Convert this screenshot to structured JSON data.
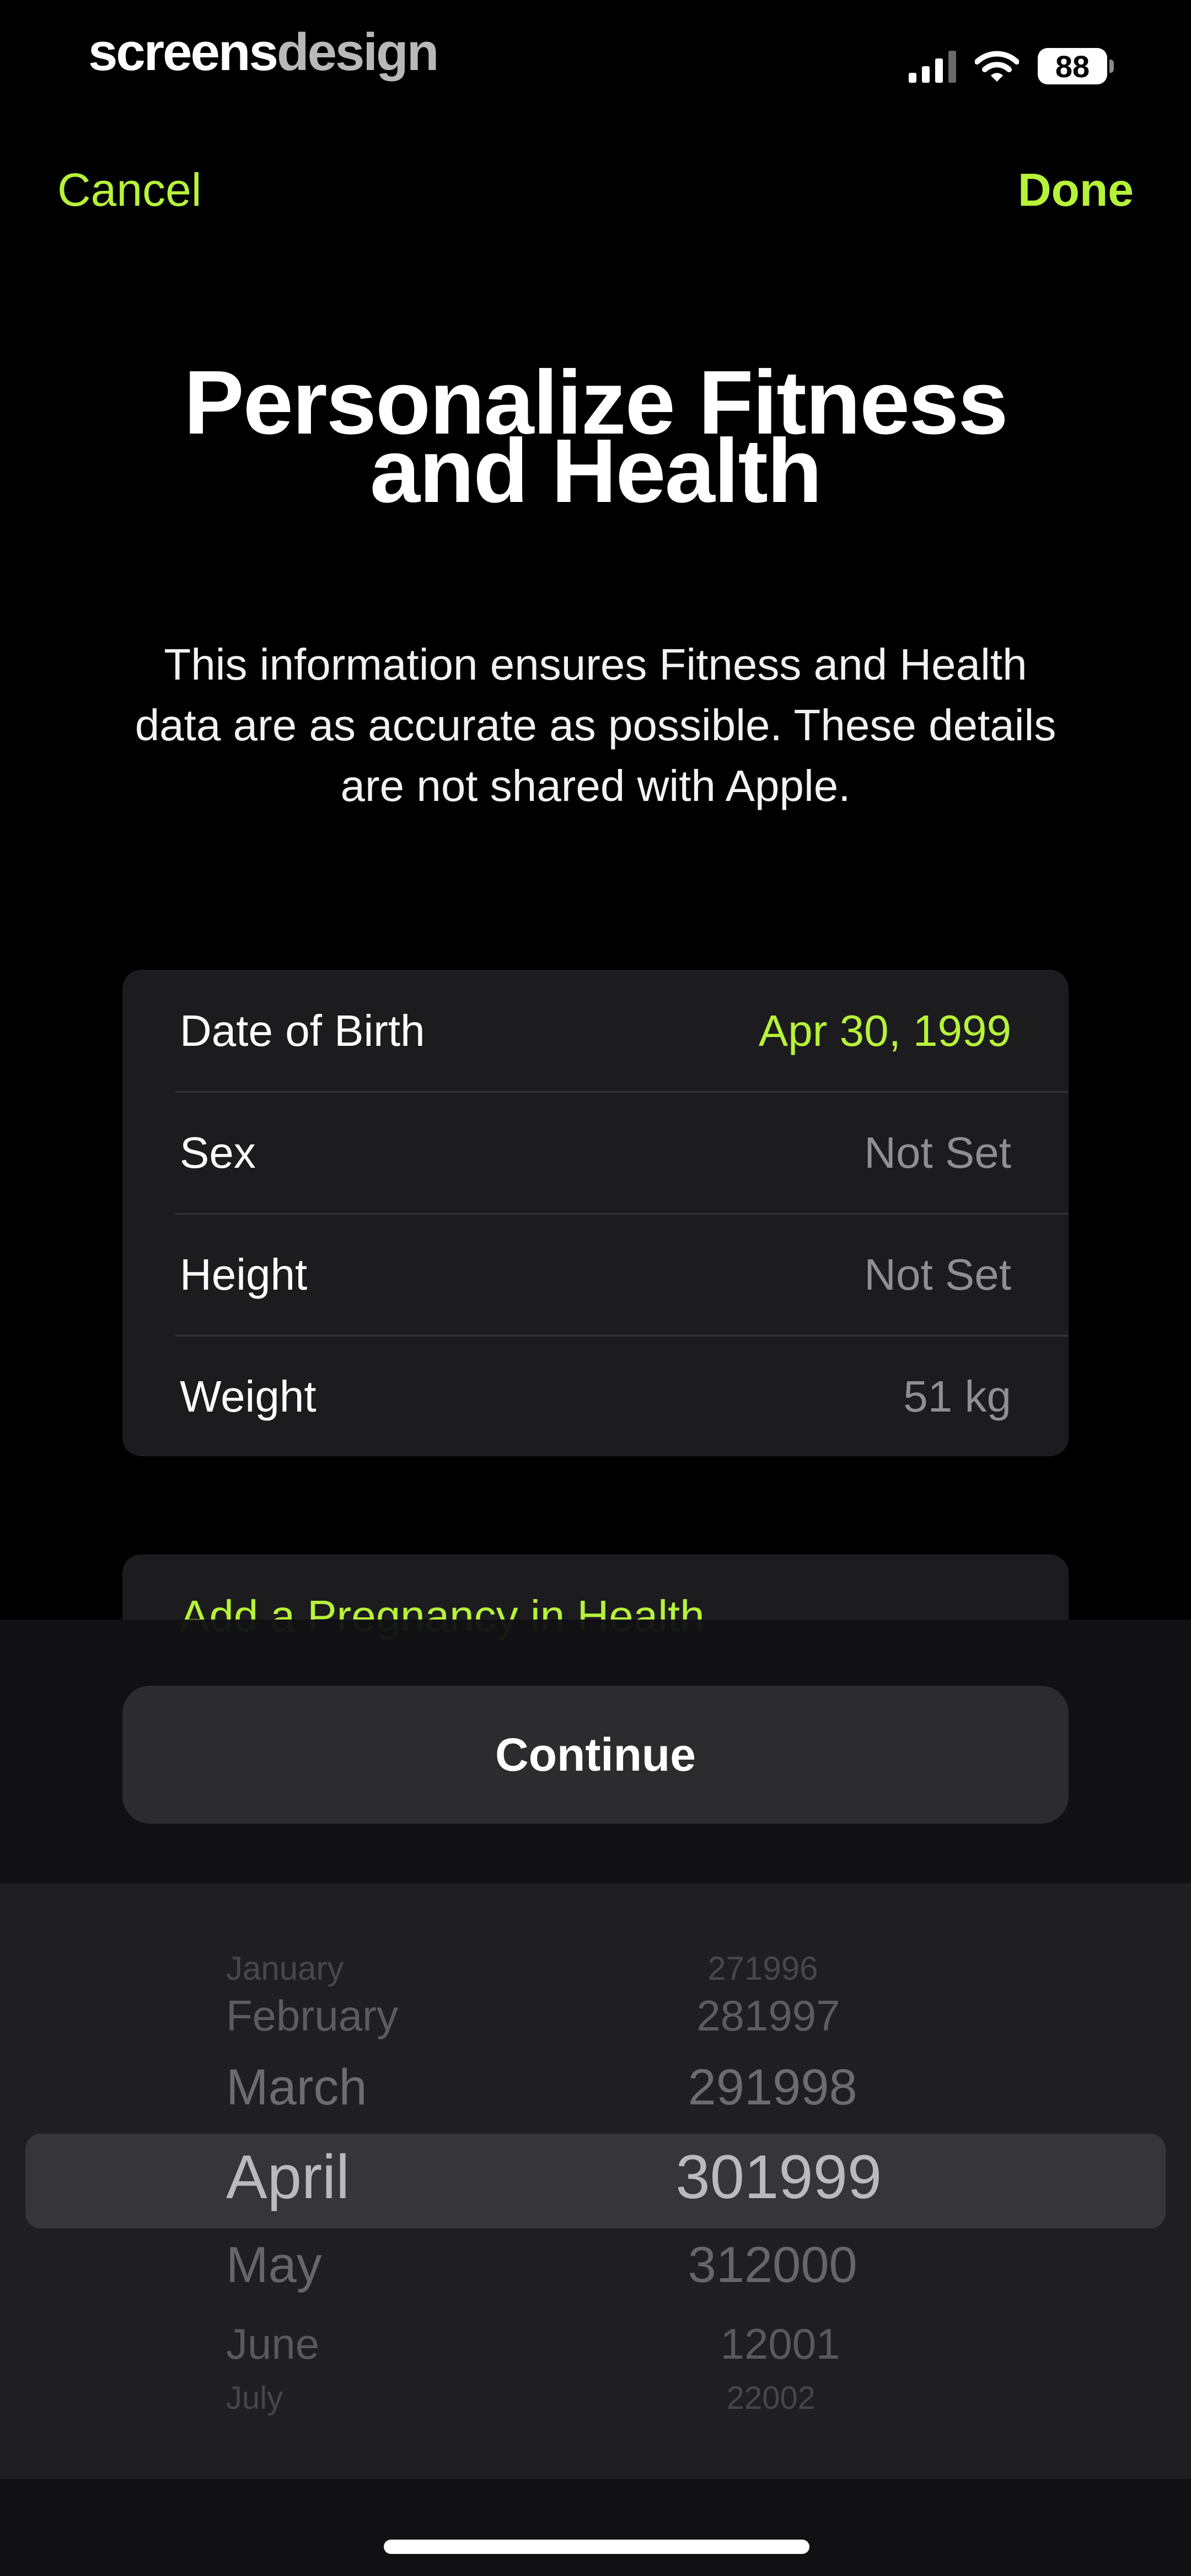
{
  "status_bar": {
    "brand_part1": "screens",
    "brand_part2": "design",
    "battery": "88",
    "icons": [
      "cellular-signal-icon",
      "wifi-icon",
      "battery-icon"
    ]
  },
  "nav": {
    "cancel": "Cancel",
    "done": "Done"
  },
  "title": "Personalize Fitness and Health",
  "subtitle": "This information ensures Fitness and Health data are as accurate as possible. These details are not shared with Apple.",
  "details": [
    {
      "label": "Date of Birth",
      "value": "Apr 30, 1999"
    },
    {
      "label": "Sex",
      "value": "Not Set"
    },
    {
      "label": "Height",
      "value": "Not Set"
    },
    {
      "label": "Weight",
      "value": "51 kg"
    }
  ],
  "pregnancy_link": "Add a Pregnancy in Health",
  "continue_label": "Continue",
  "picker": {
    "months": [
      "January",
      "February",
      "March",
      "April",
      "May",
      "June",
      "July"
    ],
    "days": [
      "27",
      "28",
      "29",
      "30",
      "31",
      "1",
      "2"
    ],
    "years": [
      "1996",
      "1997",
      "1998",
      "1999",
      "2000",
      "2001",
      "2002"
    ],
    "selected_month": "April",
    "selected_day": "30",
    "selected_year": "1999"
  },
  "colors": {
    "accent": "#b7f23a",
    "background": "#000000",
    "card": "#1c1c1e",
    "secondary_text": "#8e8e93"
  }
}
